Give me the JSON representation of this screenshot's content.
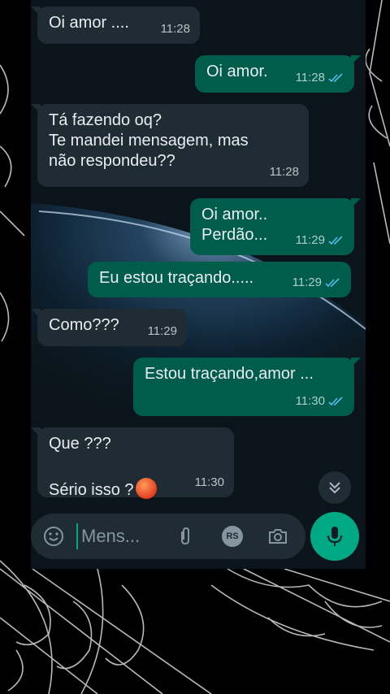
{
  "messages": [
    {
      "dir": "in",
      "text": "Oi amor ....",
      "time": "11:28"
    },
    {
      "dir": "out",
      "text": "Oi amor.",
      "time": "11:28"
    },
    {
      "dir": "in",
      "text": "Tá fazendo oq?\nTe mandei mensagem, mas\nnão respondeu??",
      "time": "11:28"
    },
    {
      "dir": "out",
      "text": "Oi amor..\nPerdão...",
      "time": "11:29"
    },
    {
      "dir": "out",
      "text": "Eu estou traçando.....",
      "time": "11:29"
    },
    {
      "dir": "in",
      "text": "Como???",
      "time": "11:29"
    },
    {
      "dir": "out",
      "text": "Estou traçando,amor ...",
      "time": "11:30"
    },
    {
      "dir": "in",
      "text_line1": "Que ???",
      "text_line2": "Sério isso ?",
      "emoji": "angry-face",
      "time": "11:30"
    }
  ],
  "composer": {
    "placeholder": "Mens...",
    "rs_badge": "RS",
    "icons": [
      "emoji-icon",
      "attach-icon",
      "rs-icon",
      "camera-icon",
      "mic-icon"
    ]
  },
  "colors": {
    "incoming": "#202c33",
    "outgoing": "#005c4b",
    "accent": "#00a884",
    "tick_read": "#53bdeb"
  }
}
